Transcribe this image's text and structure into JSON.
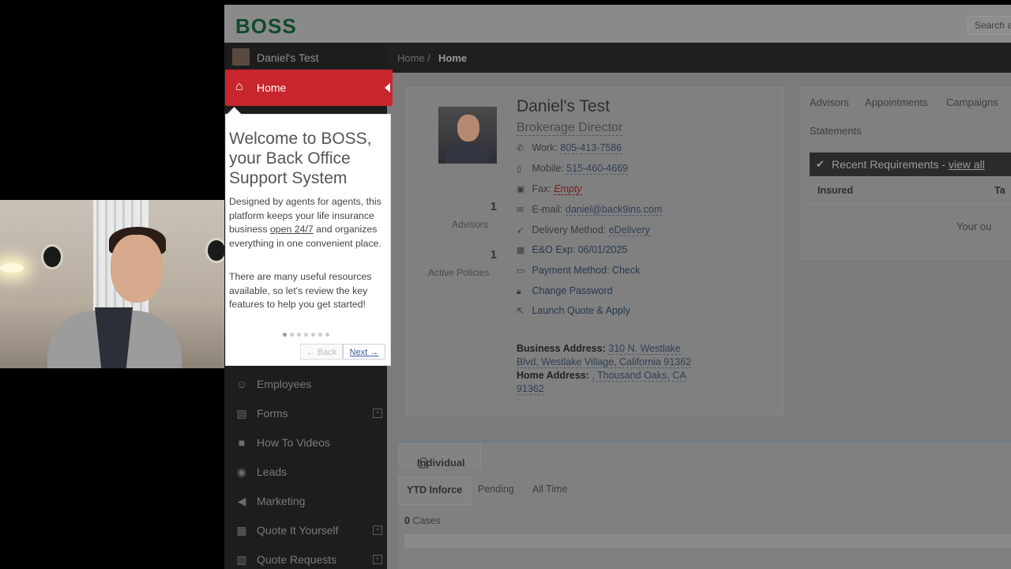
{
  "topbar": {
    "logo": "BOSS",
    "search_placeholder": "Search a"
  },
  "sidebar": {
    "user_name": "Daniel's Test",
    "home_label": "Home",
    "items": [
      {
        "label": "Employees",
        "icon": "employees-icon",
        "expandable": false
      },
      {
        "label": "Forms",
        "icon": "file-icon",
        "expandable": true
      },
      {
        "label": "How To Videos",
        "icon": "video-icon",
        "expandable": false
      },
      {
        "label": "Leads",
        "icon": "target-icon",
        "expandable": false
      },
      {
        "label": "Marketing",
        "icon": "megaphone-icon",
        "expandable": false
      },
      {
        "label": "Quote It Yourself",
        "icon": "calculator-icon",
        "expandable": true
      },
      {
        "label": "Quote Requests",
        "icon": "chart-icon",
        "expandable": true
      }
    ]
  },
  "breadcrumb": {
    "home": "Home",
    "separator": "/",
    "current": "Home"
  },
  "profile": {
    "name": "Daniel's Test",
    "title": "Brokerage Director",
    "stats": [
      {
        "value": "1",
        "label": "Advisors"
      },
      {
        "value": "1",
        "label": "Active Policies"
      }
    ],
    "work_label": "Work:",
    "work_value": "805-413-7586",
    "mobile_label": "Mobile:",
    "mobile_value": "515-460-4669",
    "fax_label": "Fax:",
    "fax_value": "Empty",
    "email_label": "E-mail:",
    "email_value": "daniel@back9ins.com",
    "delivery_label": "Delivery Method:",
    "delivery_value": "eDelivery",
    "eo_text": "E&O Exp: 06/01/2025",
    "payment_text": "Payment Method: Check",
    "change_password": "Change Password",
    "launch_quote": "Launch Quote & Apply",
    "business_address_label": "Business Address:",
    "business_address_value": "310 N. Westlake Blvd, Westlake Village, California 91362",
    "home_address_label": "Home Address:",
    "home_address_value": ", Thousand Oaks, CA 91362"
  },
  "right_panel": {
    "tabs": [
      "Advisors",
      "Appointments",
      "Campaigns",
      "Statements"
    ],
    "requirements_title": "Recent Requirements -",
    "requirements_link": "view all",
    "col_insured": "Insured",
    "col_second": "Ta",
    "empty_text": "Your ou"
  },
  "production": {
    "tab": "Individual",
    "subtabs": [
      "YTD Inforce",
      "Pending",
      "All Time"
    ],
    "cases_count": "0",
    "cases_label": "Cases"
  },
  "tour": {
    "title": "Welcome to BOSS, your Back Office Support System",
    "p1_before": "Designed by agents for agents, this platform keeps your life insurance business",
    "p1_link": "open 24/7",
    "p1_after": "and organizes everything in one convenient place.",
    "p2": "There are many useful resources available, so let's review the key features to help you get started!",
    "step_total": 7,
    "step_current": 1,
    "back_label": "← Back",
    "next_label": "Next →"
  }
}
